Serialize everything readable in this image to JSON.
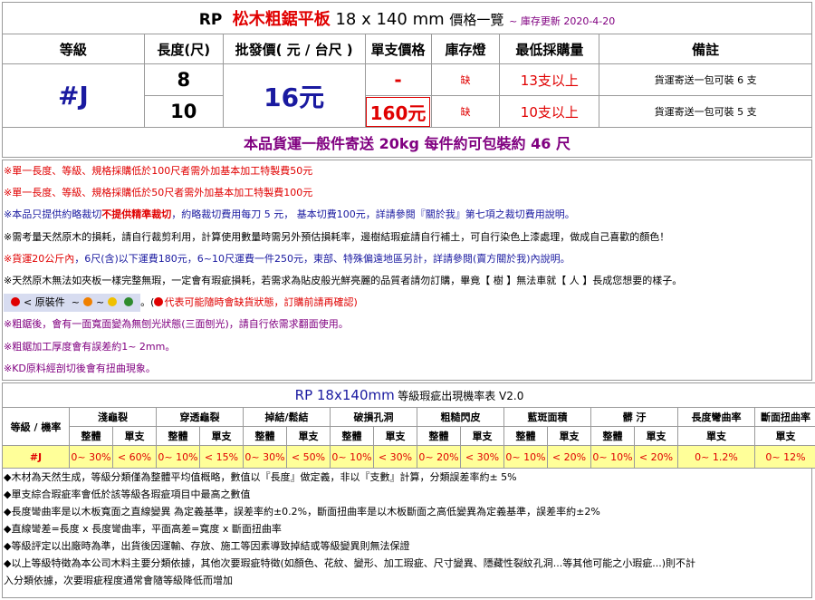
{
  "header": {
    "brand": "RP",
    "product_name": "松木粗鋸平板",
    "dimensions": "18 x 140 mm",
    "suffix": "價格一覽",
    "update": "~ 庫存更新 2020-4-20"
  },
  "columns": [
    "等級",
    "長度(尺)",
    "批發價( 元 / 台尺 )",
    "單支價格",
    "庫存燈",
    "最低採購量",
    "備註"
  ],
  "grade": "#J",
  "wholesale_price": "16元",
  "rows": [
    {
      "length": "8",
      "unit_price": "-",
      "stock": "缺",
      "min_qty": "13支以上",
      "remark": "貨運寄送一包可裝 6 支"
    },
    {
      "length": "10",
      "unit_price": "160元",
      "stock": "缺",
      "min_qty": "10支以上",
      "remark": "貨運寄送一包可裝 5 支"
    }
  ],
  "shipping_note": "本品貨運一般件寄送 20kg 每件約可包裝約 46 尺",
  "notes": {
    "n1": "※單一長度、等級、規格採購低於100尺者需外加基本加工特製費50元",
    "n2": "※單一長度、等級、規格採購低於50尺者需外加基本加工特製費100元",
    "n3a": "※本品只提供約略裁切",
    "n3b": "不提供精準裁切",
    "n3c": "，約略裁切費用每刀 5 元， 基本切費100元，詳請參閱『關於我』第七項之裁切費用說明。",
    "n4": "※需考量天然原木的損耗，請自行裁剪利用，計算使用數量時需另外預估損耗率，邊樹結瑕疵請自行補土，可自行染色上漆處理，做成自己喜歡的顏色！",
    "n5a": "※貨運20公斤內",
    "n5b": "，6尺(含)以下運費180元，6~10尺運費一件250元，東部、特殊偏遠地區另計，詳請參閱(賣方關於我)內說明。",
    "n6": "※天然原木無法如夾板一樣完整無瑕，一定會有瑕疵損耗，若需求為貼皮般光鮮亮麗的品質者請勿訂購，畢竟【 樹 】無法車就【 人 】長成您想要的樣子。",
    "legend_label": "< 原裝件",
    "legend_tilde1": "~",
    "legend_tilde2": "~",
    "legend_dot_colors": [
      "#e00000",
      "#f08000",
      "#f0c000",
      "#2e8b2e"
    ],
    "n7a": "。(",
    "n7b": "代表可能隨時會缺貨狀態，訂購前請再確認)",
    "n8": "※粗鋸後，會有一面寬面變為無刨光狀態(三面刨光)，請自行依需求翻面使用。",
    "n9": "※粗鋸加工厚度會有誤差約1~ 2mm。",
    "n10": "※KD原料經剖切後會有扭曲現象。"
  },
  "defect_table": {
    "title_prefix": "RP 18x140mm",
    "title_suffix": "等級瑕疵出現機率表 V2.0",
    "row_label": "等級 / 機率",
    "categories": [
      "淺龜裂",
      "穿透龜裂",
      "掉結/鬆結",
      "破損孔洞",
      "粗糙閃皮",
      "藍斑面積",
      "髒 汙",
      "長度彎曲率",
      "斷面扭曲率"
    ],
    "sub_whole": "整體",
    "sub_single": "單支",
    "grade": "#J",
    "values": [
      "0~ 30%",
      "< 60%",
      "0~ 10%",
      "< 15%",
      "0~ 30%",
      "< 50%",
      "0~ 10%",
      "< 30%",
      "0~ 20%",
      "< 30%",
      "0~ 10%",
      "< 20%",
      "0~ 10%",
      "< 20%",
      "0~ 1.2%",
      "0~ 12%"
    ]
  },
  "footnotes": [
    "◆木材為天然生成，等級分類僅為整體平均值概略，數值以『長度』做定義，非以『支數』計算，分類誤差率約± 5%",
    "◆單支綜合瑕疵率會低於該等級各瑕疵項目中最高之數值",
    "◆長度彎曲率是以木板寬面之直線變異 為定義基準，誤差率約±0.2%，斷面扭曲率是以木板斷面之高低變異為定義基準，誤差率約±2%",
    "◆直線彎差=長度 x 長度彎曲率，平面高差=寬度 x 斷面扭曲率",
    "◆等級評定以出廠時為準，出貨後因運輸、存放、施工等因素導致掉結或等級變異則無法保證",
    "◆以上等級特徵為本公司木料主要分類依據，其他次要瑕疵特徵(如顏色、花紋、變形、加工瑕疵、尺寸變異、隱藏性裂紋孔洞...等其他可能之小瑕疵...)則不計",
    "入分類依據，次要瑕疵程度通常會隨等級降低而增加"
  ]
}
